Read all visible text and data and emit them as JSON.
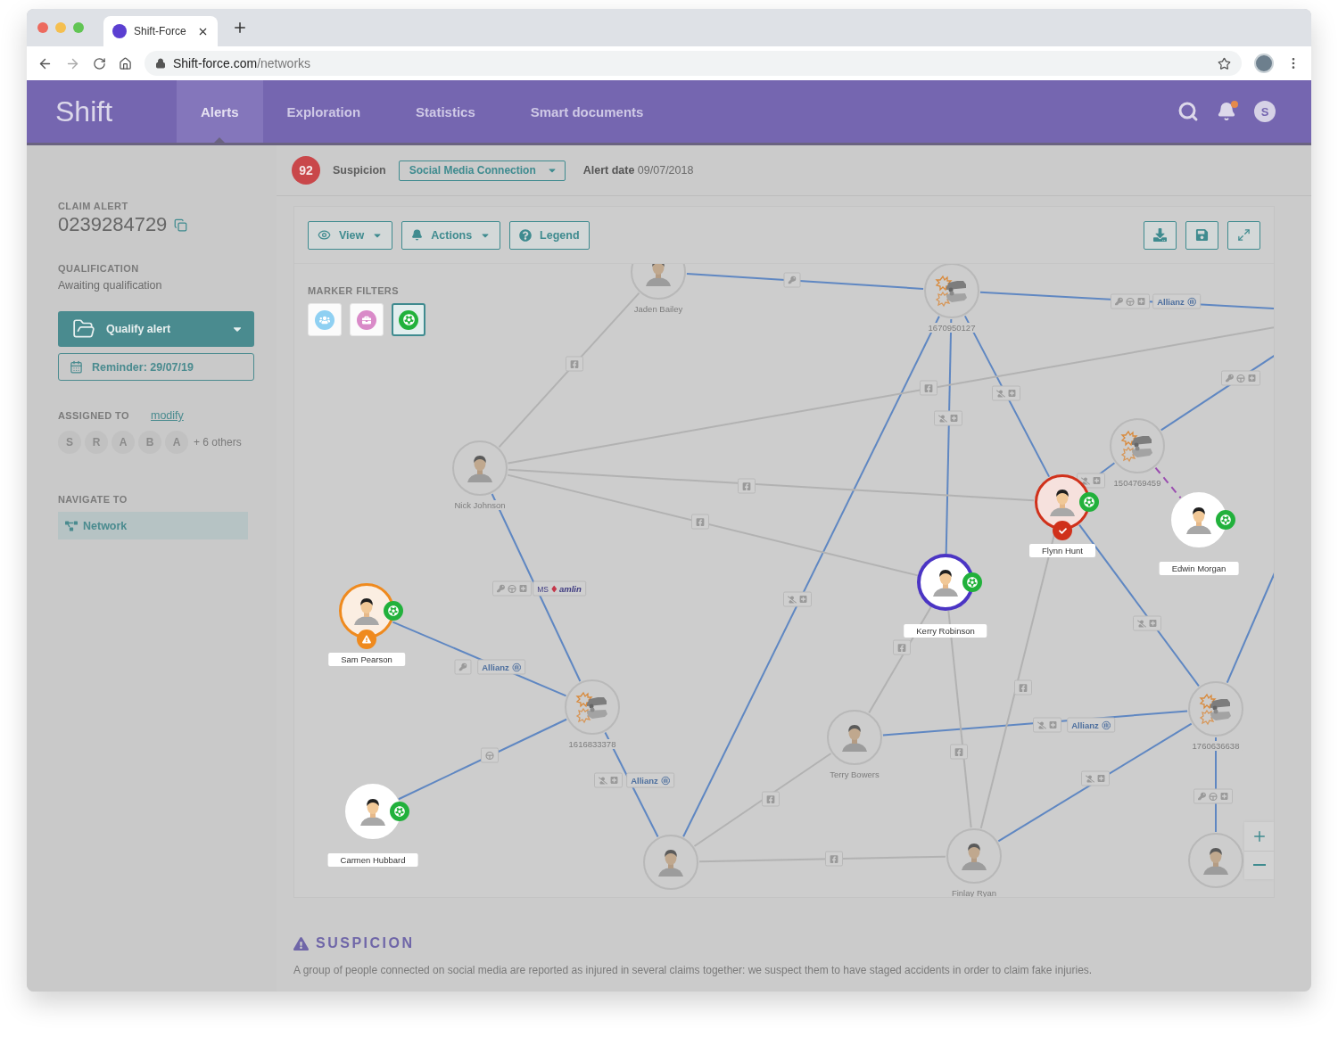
{
  "browser": {
    "tab_title": "Shift-Force",
    "url": {
      "host": "Shift-force.com",
      "path": "/networks"
    }
  },
  "app": {
    "logo": "Shift",
    "tabs": [
      {
        "label": "Alerts",
        "selected": true
      },
      {
        "label": "Exploration",
        "selected": false
      },
      {
        "label": "Statistics",
        "selected": false
      },
      {
        "label": "Smart documents",
        "selected": false
      }
    ],
    "notifications": {
      "unread": true
    },
    "user_initial": "S"
  },
  "sidebar": {
    "claim_label": "CLAIM ALERT",
    "claim_number": "0239284729",
    "qualification_label": "QUALIFICATION",
    "qualification": "Awaiting qualification",
    "qualify_button": "Qualify alert",
    "reminder": "Reminder: 29/07/19",
    "assigned_label": "ASSIGNED TO",
    "modify_link": "modify",
    "assignees": [
      "S",
      "R",
      "A",
      "B",
      "A"
    ],
    "others": "+ 6 others",
    "navigate_label": "NAVIGATE TO",
    "navigation": [
      {
        "label": "Network",
        "selected": true
      }
    ]
  },
  "alert_header": {
    "score": "92",
    "suspicion_label": "Suspicion",
    "suspicion": "Social Media Connection",
    "alert_date": "**Alert date** 09/07/2018"
  },
  "graph": {
    "toolbar": {
      "buttons": [
        {
          "kind": "view",
          "label": "View"
        },
        {
          "kind": "actions",
          "label": "Actions"
        },
        {
          "kind": "legend",
          "label": "Legend"
        }
      ]
    },
    "marker_filters": {
      "title": "MARKER FILTERS",
      "items": [
        {
          "kind": "group",
          "selected": false
        },
        {
          "kind": "work",
          "selected": false
        },
        {
          "kind": "sports",
          "selected": true
        }
      ]
    },
    "nodes": [
      {
        "kind": "person",
        "name": "Jaden Bailey",
        "dimmed": true,
        "selected": false,
        "warning": false,
        "confirmed": false,
        "sports_marker": false
      },
      {
        "kind": "person",
        "name": "Nick Johnson",
        "dimmed": true,
        "selected": false,
        "warning": false,
        "confirmed": false,
        "sports_marker": false
      },
      {
        "kind": "person",
        "name": "Sam Pearson",
        "dimmed": false,
        "selected": false,
        "warning": true,
        "confirmed": false,
        "sports_marker": true
      },
      {
        "kind": "person",
        "name": "Carmen Hubbard",
        "dimmed": false,
        "selected": false,
        "warning": false,
        "confirmed": false,
        "sports_marker": true
      },
      {
        "kind": "person",
        "name": "Kerry Robinson",
        "dimmed": false,
        "selected": true,
        "warning": false,
        "confirmed": false,
        "sports_marker": true
      },
      {
        "kind": "person",
        "name": "Flynn Hunt",
        "dimmed": false,
        "selected": false,
        "warning": false,
        "confirmed": true,
        "sports_marker": true
      },
      {
        "kind": "person",
        "name": "Edwin Morgan",
        "dimmed": false,
        "selected": false,
        "warning": false,
        "confirmed": false,
        "sports_marker": true
      },
      {
        "kind": "person",
        "name": "Terry Bowers",
        "dimmed": true,
        "selected": false,
        "warning": false,
        "confirmed": false,
        "sports_marker": false
      },
      {
        "kind": "person",
        "dimmed": true,
        "selected": false,
        "warning": false,
        "confirmed": false,
        "sports_marker": false
      },
      {
        "kind": "person",
        "name": "Finlay Ryan",
        "dimmed": true,
        "selected": false,
        "warning": false,
        "confirmed": false,
        "sports_marker": false
      },
      {
        "kind": "person",
        "dimmed": true,
        "selected": false,
        "warning": false,
        "confirmed": false,
        "sports_marker": false
      },
      {
        "kind": "claim",
        "number": "1670950127"
      },
      {
        "kind": "claim",
        "number": "1504769459"
      },
      {
        "kind": "claim",
        "number": "1616833378"
      },
      {
        "kind": "claim",
        "number": "1760636638"
      }
    ],
    "edges": [
      {
        "kind": "insurance",
        "chips": [
          {
            "kind": "owner"
          }
        ]
      },
      {
        "kind": "insurance",
        "chips": [
          {
            "kind": "owner-driver-injury"
          },
          {
            "kind": "insurer",
            "name": "Allianz"
          }
        ]
      },
      {
        "kind": "insurance",
        "chips": [
          {
            "kind": "passenger-injury"
          }
        ]
      },
      {
        "kind": "insurance",
        "chips": [
          {
            "kind": "passenger-injury"
          }
        ]
      },
      {
        "kind": "insurance",
        "chips": [
          {
            "kind": "passenger-injury"
          }
        ]
      },
      {
        "kind": "insurance",
        "chips": [
          {
            "kind": "owner-driver-injury"
          }
        ]
      },
      {
        "kind": "insurance",
        "chips": [
          {
            "kind": "passenger-injury"
          }
        ]
      },
      {
        "kind": "family"
      },
      {
        "kind": "insurance",
        "chips": [
          {
            "kind": "passenger-injury"
          }
        ]
      },
      {
        "kind": "insurance"
      },
      {
        "kind": "insurance",
        "chips": [
          {
            "kind": "passenger-injury"
          },
          {
            "kind": "insurer",
            "name": "Allianz"
          }
        ]
      },
      {
        "kind": "insurance",
        "chips": [
          {
            "kind": "passenger-injury"
          }
        ]
      },
      {
        "kind": "insurance",
        "chips": [
          {
            "kind": "owner-driver-injury"
          }
        ]
      },
      {
        "kind": "insurance",
        "chips": [
          {
            "kind": "owner"
          },
          {
            "kind": "insurer",
            "name": "Allianz"
          }
        ]
      },
      {
        "kind": "insurance",
        "chips": [
          {
            "kind": "driver"
          }
        ]
      },
      {
        "kind": "insurance",
        "chips": [
          {
            "kind": "owner-driver-injury"
          },
          {
            "kind": "insurer",
            "prefix": "MS",
            "name": "amlin"
          }
        ]
      },
      {
        "kind": "insurance",
        "chips": [
          {
            "kind": "passenger-injury"
          },
          {
            "kind": "insurer",
            "name": "Allianz"
          }
        ]
      },
      {
        "kind": "social",
        "chips": [
          {
            "kind": "facebook"
          }
        ]
      },
      {
        "kind": "social",
        "chips": [
          {
            "kind": "facebook"
          }
        ]
      },
      {
        "kind": "social",
        "chips": [
          {
            "kind": "facebook"
          }
        ]
      },
      {
        "kind": "social",
        "chips": [
          {
            "kind": "facebook"
          }
        ]
      },
      {
        "kind": "social",
        "chips": [
          {
            "kind": "facebook"
          }
        ]
      },
      {
        "kind": "social",
        "chips": [
          {
            "kind": "facebook"
          }
        ]
      },
      {
        "kind": "social",
        "chips": [
          {
            "kind": "facebook"
          }
        ]
      },
      {
        "kind": "social",
        "chips": [
          {
            "kind": "facebook"
          }
        ]
      },
      {
        "kind": "social",
        "chips": [
          {
            "kind": "facebook"
          }
        ]
      }
    ]
  },
  "suspicion": {
    "title": "SUSPICION",
    "text": "A group of people connected on social media are reported as injured in several claims together: we suspect them to have staged accidents in order to claim fake injuries."
  }
}
